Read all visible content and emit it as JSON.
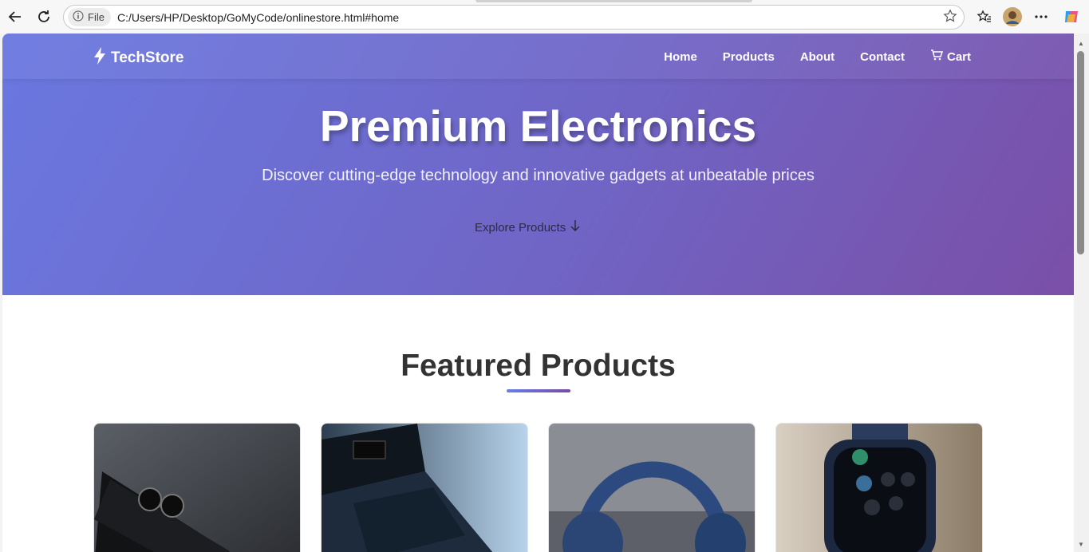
{
  "browser": {
    "file_chip": "File",
    "url": "C:/Users/HP/Desktop/GoMyCode/onlinestore.html#home"
  },
  "site": {
    "logo_text": "TechStore",
    "nav": [
      "Home",
      "Products",
      "About",
      "Contact",
      "Cart"
    ]
  },
  "hero": {
    "title": "Premium Electronics",
    "subtitle": "Discover cutting-edge technology and innovative gadgets at unbeatable prices",
    "cta": "Explore Products"
  },
  "featured": {
    "title": "Featured Products"
  },
  "colors": {
    "gradient_start": "#667eea",
    "gradient_end": "#764ba2"
  },
  "icons": [
    "back-arrow-icon",
    "refresh-icon",
    "info-icon",
    "star-icon",
    "favorites-icon",
    "menu-dots-icon",
    "copilot-icon",
    "bolt-icon",
    "cart-icon",
    "arrow-down-icon"
  ]
}
